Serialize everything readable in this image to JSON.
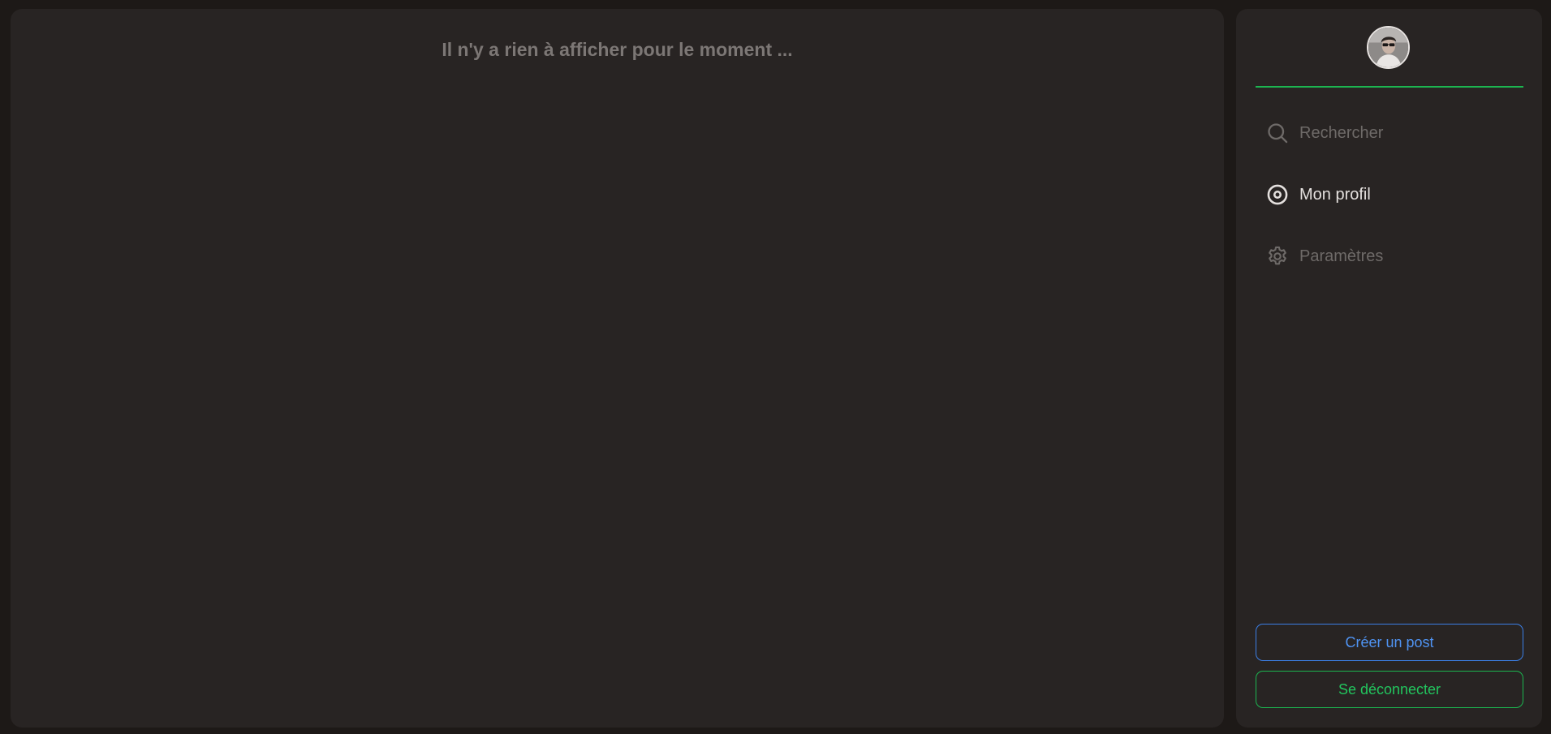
{
  "feed": {
    "empty_message": "Il n'y a rien à afficher pour le moment ..."
  },
  "sidebar": {
    "avatar": {
      "icon": "user-avatar-photo"
    },
    "nav": [
      {
        "label": "Rechercher",
        "icon": "search-icon",
        "active": false
      },
      {
        "label": "Mon profil",
        "icon": "profile-target-icon",
        "active": true
      },
      {
        "label": "Paramètres",
        "icon": "gear-icon",
        "active": false
      }
    ],
    "create_post_label": "Créer un post",
    "logout_label": "Se déconnecter"
  },
  "colors": {
    "background": "#1d1917",
    "panel": "#282423",
    "accent_green": "#22c55e",
    "accent_blue": "#4f93f2",
    "muted_text": "#6e6a68",
    "active_text": "#e4e0de"
  }
}
